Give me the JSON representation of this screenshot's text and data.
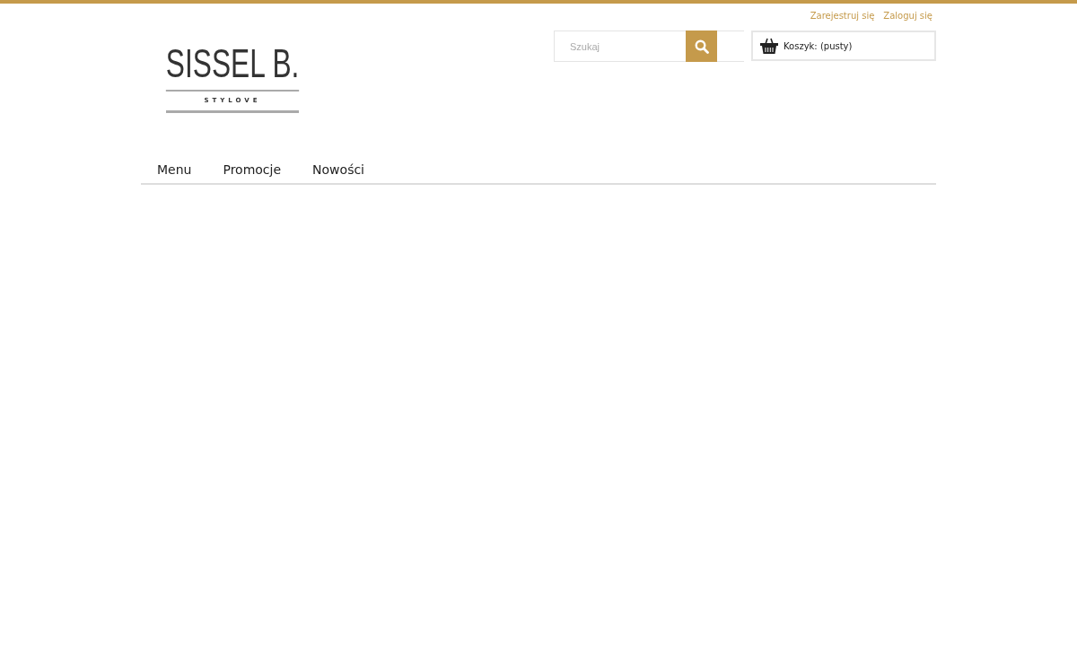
{
  "header_links": [
    "Zarejestruj się",
    "Zaloguj się"
  ],
  "logo": {
    "title": "SISSEL B.",
    "tagline": "STYLOVE"
  },
  "search": {
    "placeholder": "Szukaj"
  },
  "cart": {
    "label": "Koszyk: (pusty)"
  },
  "nav": [
    "Menu",
    "Promocje",
    "Nowości"
  ]
}
